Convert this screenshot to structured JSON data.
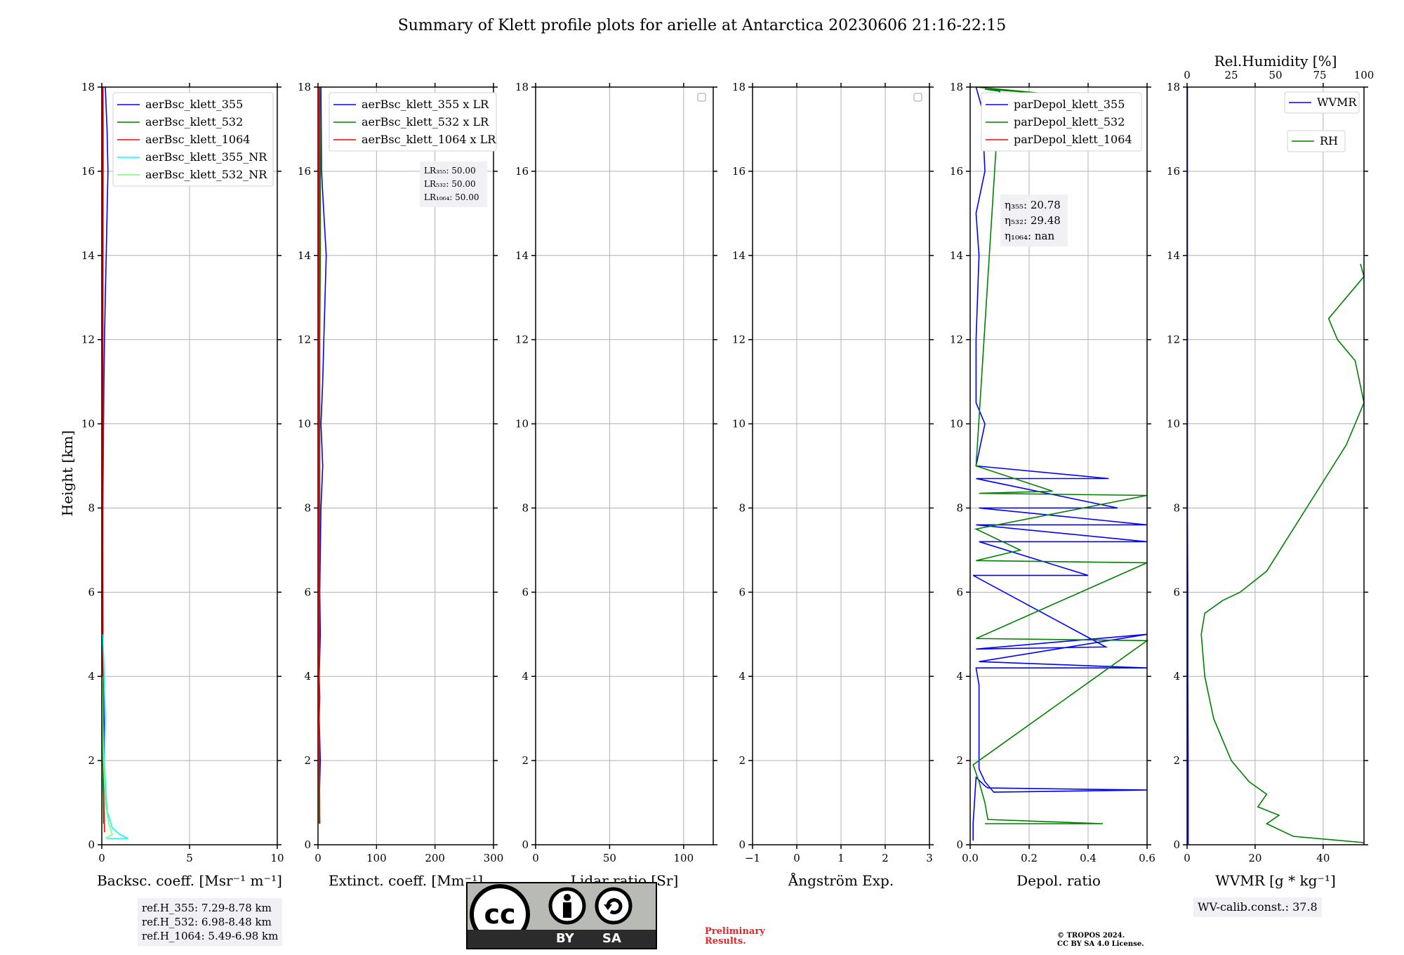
{
  "title": "Summary of Klett profile plots for arielle at Antarctica 20230606 21:16-22:15",
  "y_axis": {
    "label": "Height [km]",
    "ticks": [
      "0",
      "2",
      "4",
      "6",
      "8",
      "10",
      "12",
      "14",
      "16",
      "18"
    ],
    "range": [
      0,
      18
    ]
  },
  "colors": {
    "blue": "#0000ff",
    "green": "#008000",
    "red": "#ff0000",
    "cyan": "#00ffff",
    "lightgreen": "#77ff77",
    "grid": "#b0b0b0"
  },
  "panels": [
    {
      "id": "bsc",
      "xlabel": "Backsc. coeff. [Msr⁻¹ m⁻¹]",
      "xlim": [
        0,
        10
      ],
      "xticks": [
        "0",
        "5",
        "10"
      ],
      "legend": [
        "aerBsc_klett_355",
        "aerBsc_klett_532",
        "aerBsc_klett_1064",
        "aerBsc_klett_355_NR",
        "aerBsc_klett_532_NR"
      ],
      "legend_colors": [
        "#0000ff",
        "#008000",
        "#ff0000",
        "#00ffff",
        "#77ff77"
      ]
    },
    {
      "id": "ext",
      "xlabel": "Extinct. coeff. [Mm⁻¹]",
      "xlim": [
        0,
        300
      ],
      "xticks": [
        "0",
        "100",
        "200",
        "300"
      ],
      "legend": [
        "aerBsc_klett_355 x LR",
        "aerBsc_klett_532 x LR",
        "aerBsc_klett_1064 x LR"
      ],
      "legend_colors": [
        "#0000ff",
        "#008000",
        "#ff0000"
      ],
      "annotation": [
        "LR₃₅₅: 50.00",
        "LR₅₃₂: 50.00",
        "LR₁₀₆₄: 50.00"
      ]
    },
    {
      "id": "lr",
      "xlabel": "Lidar ratio [Sr]",
      "xlim": [
        0,
        120
      ],
      "xticks": [
        "0",
        "50",
        "100"
      ]
    },
    {
      "id": "ang",
      "xlabel": "Ångström Exp.",
      "xlim": [
        -1,
        3
      ],
      "xticks": [
        "−1",
        "0",
        "1",
        "2",
        "3"
      ]
    },
    {
      "id": "dep",
      "xlabel": "Depol. ratio",
      "xlim": [
        0,
        0.6
      ],
      "xticks": [
        "0.0",
        "0.2",
        "0.4",
        "0.6"
      ],
      "legend": [
        "parDepol_klett_355",
        "parDepol_klett_532",
        "parDepol_klett_1064"
      ],
      "legend_colors": [
        "#0000ff",
        "#008000",
        "#ff0000"
      ],
      "annotation": [
        "η₃₅₅: 20.78",
        "η₅₃₂: 29.48",
        "η₁₀₆₄: nan"
      ]
    },
    {
      "id": "wv",
      "xlabel": "WVMR [g * kg⁻¹]",
      "xlim": [
        0,
        52
      ],
      "xticks": [
        "0",
        "20",
        "40"
      ],
      "top_label": "Rel.Humidity [%]",
      "top_xticks": [
        "0",
        "25",
        "50",
        "75",
        "100"
      ],
      "legend": [
        "WVMR",
        "RH"
      ],
      "legend_colors": [
        "#0000ff",
        "#008000"
      ]
    }
  ],
  "chart_data": [
    {
      "type": "line",
      "panel": "bsc",
      "ylabel": "Height [km]",
      "xlabel": "Backsc. coeff. [Msr⁻¹ m⁻¹]",
      "xlim": [
        0,
        10
      ],
      "ylim": [
        0,
        18
      ],
      "series": [
        {
          "name": "aerBsc_klett_355",
          "x": [
            0.12,
            0.1,
            0.08,
            0.15,
            0.1,
            0.06,
            0.05,
            0.05,
            0.06,
            0.08,
            0.1,
            0.12,
            0.15,
            0.2,
            0.25,
            0.3,
            0.35,
            0.3,
            0.2
          ],
          "y": [
            0.5,
            1,
            1.5,
            2.5,
            3.5,
            4.5,
            6,
            7,
            8,
            9,
            10,
            11,
            12,
            13,
            14,
            15,
            16,
            17,
            18
          ]
        },
        {
          "name": "aerBsc_klett_532",
          "x": [
            0.1,
            0.08,
            0.05,
            0.04,
            0.04,
            0.05,
            0.05,
            0.06,
            0.07,
            0.08,
            0.08,
            0.07
          ],
          "y": [
            0.5,
            1.5,
            3,
            5,
            7,
            9,
            10,
            12,
            14,
            16,
            17,
            18
          ]
        },
        {
          "name": "aerBsc_klett_1064",
          "x": [
            0.15,
            0.12,
            0.1,
            0.08,
            0.06,
            0.05,
            0.05,
            0.05,
            0.05,
            0.05
          ],
          "y": [
            0.3,
            1,
            2,
            4,
            6,
            8,
            10,
            12,
            15,
            18
          ]
        },
        {
          "name": "aerBsc_klett_355_NR",
          "x": [
            0.3,
            1.5,
            1.0,
            0.6,
            0.3,
            0.2,
            0.15,
            0.2,
            0.15,
            0.1,
            0.05
          ],
          "y": [
            0.15,
            0.15,
            0.25,
            0.4,
            0.8,
            1.5,
            2,
            3,
            3.8,
            4.5,
            5
          ]
        },
        {
          "name": "aerBsc_klett_532_NR",
          "x": [
            0.2,
            0.6,
            0.4,
            0.2,
            0.1,
            0.05,
            0.03
          ],
          "y": [
            0.15,
            0.25,
            0.5,
            1,
            2,
            3,
            4
          ]
        }
      ]
    },
    {
      "type": "line",
      "panel": "ext",
      "xlabel": "Extinct. coeff. [Mm⁻¹]",
      "xlim": [
        0,
        300
      ],
      "ylim": [
        0,
        18
      ],
      "series": [
        {
          "name": "aerBsc_klett_355 x LR",
          "x": [
            3,
            2,
            4,
            2,
            3,
            2,
            4,
            3,
            4,
            5,
            8,
            5,
            8,
            10,
            12,
            14,
            10,
            6,
            5
          ],
          "y": [
            0.5,
            1,
            2,
            3,
            3.5,
            4,
            5,
            6,
            7,
            8,
            9,
            10,
            11,
            12,
            13,
            14,
            15,
            16,
            18
          ]
        },
        {
          "name": "aerBsc_klett_532 x LR",
          "x": [
            2,
            2,
            2,
            2,
            3,
            3,
            3,
            4,
            4,
            3
          ],
          "y": [
            0.5,
            2,
            4,
            6,
            8,
            10,
            12,
            14,
            16,
            18
          ]
        },
        {
          "name": "aerBsc_klett_1064 x LR",
          "x": [
            3,
            2,
            2,
            2,
            2,
            2
          ],
          "y": [
            0.5,
            3,
            6,
            10,
            14,
            18
          ]
        }
      ]
    },
    {
      "type": "line",
      "panel": "lr",
      "xlabel": "Lidar ratio [Sr]",
      "xlim": [
        0,
        120
      ],
      "ylim": [
        0,
        18
      ],
      "series": []
    },
    {
      "type": "line",
      "panel": "ang",
      "xlabel": "Ångström Exp.",
      "xlim": [
        -1,
        3
      ],
      "ylim": [
        0,
        18
      ],
      "series": []
    },
    {
      "type": "line",
      "panel": "dep",
      "xlabel": "Depol. ratio",
      "xlim": [
        0,
        0.6
      ],
      "ylim": [
        0,
        18
      ],
      "series": [
        {
          "name": "parDepol_klett_355",
          "x": [
            0.01,
            0.01,
            0.02,
            0.05,
            0.06,
            0.6,
            0.08,
            0.05,
            0.03,
            0.03,
            0.02,
            0.6,
            0.03,
            0.6,
            0.02,
            0.46,
            0.01,
            0.4,
            0.03,
            0.6,
            0.02,
            0.6,
            0.03,
            0.5,
            0.02,
            0.47,
            0.02,
            0.05,
            0.02,
            0.02,
            0.03,
            0.02,
            0.05,
            0.04,
            0.02
          ],
          "y": [
            0.1,
            0.5,
            1.6,
            1.4,
            1.35,
            1.3,
            1.25,
            1.5,
            1.8,
            3.8,
            4.2,
            4.2,
            4.35,
            5.0,
            4.65,
            4.7,
            6.4,
            6.4,
            7.2,
            7.2,
            7.6,
            7.6,
            8.0,
            8.0,
            8.7,
            8.7,
            9.0,
            10,
            10.5,
            12,
            14,
            15,
            16,
            17.5,
            18
          ]
        },
        {
          "name": "parDepol_klett_532",
          "x": [
            0.05,
            0.45,
            0.06,
            0.05,
            0.03,
            0.02,
            0.01,
            0.6,
            0.02,
            0.6,
            0.02,
            0.17,
            0.02,
            0.6,
            0.03,
            0.28,
            0.02,
            0.1,
            0.05,
            0.25,
            0.02
          ],
          "y": [
            0.5,
            0.5,
            0.6,
            1.0,
            1.5,
            1.7,
            1.9,
            4.85,
            4.9,
            6.7,
            6.75,
            7.0,
            7.5,
            8.3,
            8.35,
            8.4,
            9,
            17.9,
            17.95,
            17.85,
            18
          ]
        }
      ]
    },
    {
      "type": "line",
      "panel": "wv",
      "xlabel": "WVMR [g * kg⁻¹]",
      "xlim": [
        0,
        52
      ],
      "ylim": [
        0,
        18
      ],
      "top_xlabel": "Rel.Humidity [%]",
      "top_xlim": [
        0,
        100
      ],
      "series": [
        {
          "name": "WVMR",
          "x": [
            0.3,
            0.3,
            0.2,
            0.2,
            0.1,
            0.1,
            0.1,
            0.1,
            0.1,
            0.1
          ],
          "y": [
            0,
            2,
            4,
            6,
            8,
            10,
            12,
            14,
            16,
            18
          ]
        },
        {
          "name": "RH",
          "x": [
            100,
            60,
            45,
            52,
            40,
            45,
            35,
            25,
            15,
            10,
            8,
            10,
            20,
            30,
            45,
            60,
            75,
            90,
            100,
            95,
            85,
            80,
            90,
            100,
            98
          ],
          "y": [
            0.05,
            0.2,
            0.5,
            0.7,
            0.9,
            1.2,
            1.5,
            2,
            3,
            4,
            5,
            5.5,
            5.8,
            6,
            6.5,
            7.5,
            8.5,
            9.5,
            10.5,
            11.5,
            12,
            12.5,
            13,
            13.5,
            13.8
          ]
        }
      ]
    }
  ],
  "footer": {
    "ref_heights": [
      "ref.H_355: 7.29-8.78 km",
      "ref.H_532: 6.98-8.48 km",
      "ref.H_1064: 5.49-6.98 km"
    ],
    "cc_badge": {
      "by": "BY",
      "sa": "SA",
      "cc": "cc"
    },
    "preliminary": [
      "Preliminary",
      "Results."
    ],
    "copyright": [
      "© TROPOS 2024.",
      "CC BY SA 4.0 License."
    ],
    "wv_calib": "WV-calib.const.: 37.8"
  }
}
